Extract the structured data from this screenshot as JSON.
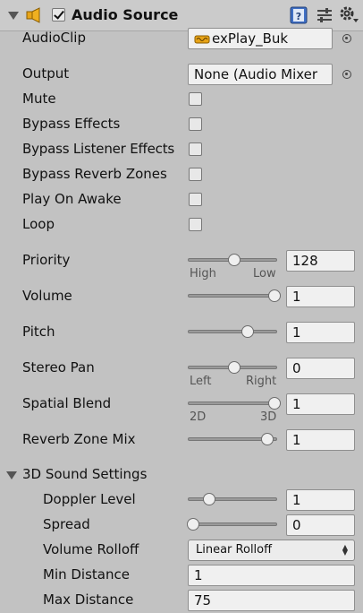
{
  "component": {
    "title": "Audio Source",
    "enabled": true,
    "icons": [
      "collapse-arrow-icon",
      "speaker-icon",
      "help-book-icon",
      "presets-icon",
      "gear-icon"
    ]
  },
  "fields": {
    "audio_clip": {
      "label": "AudioClip",
      "value": "exPlay_Buk"
    },
    "output": {
      "label": "Output",
      "value": "None (Audio Mixer"
    },
    "mute": {
      "label": "Mute",
      "checked": false
    },
    "bypass_effects": {
      "label": "Bypass Effects",
      "checked": false
    },
    "bypass_listener_effects": {
      "label": "Bypass Listener Effects",
      "checked": false
    },
    "bypass_reverb_zones": {
      "label": "Bypass Reverb Zones",
      "checked": false
    },
    "play_on_awake": {
      "label": "Play On Awake",
      "checked": false
    },
    "loop": {
      "label": "Loop",
      "checked": false
    },
    "priority": {
      "label": "Priority",
      "value": "128",
      "min": 0,
      "max": 256,
      "left_label": "High",
      "right_label": "Low"
    },
    "volume": {
      "label": "Volume",
      "value": "1",
      "min": 0,
      "max": 1
    },
    "pitch": {
      "label": "Pitch",
      "value": "1",
      "min": -3,
      "max": 3
    },
    "stereo_pan": {
      "label": "Stereo Pan",
      "value": "0",
      "min": -1,
      "max": 1,
      "left_label": "Left",
      "right_label": "Right"
    },
    "spatial_blend": {
      "label": "Spatial Blend",
      "value": "1",
      "min": 0,
      "max": 1,
      "left_label": "2D",
      "right_label": "3D"
    },
    "reverb_zone_mix": {
      "label": "Reverb Zone Mix",
      "value": "1",
      "min": 0,
      "max": 1.1
    }
  },
  "sound3d": {
    "title": "3D Sound Settings",
    "doppler_level": {
      "label": "Doppler Level",
      "value": "1",
      "min": 0,
      "max": 5
    },
    "spread": {
      "label": "Spread",
      "value": "0",
      "min": 0,
      "max": 360
    },
    "volume_rolloff": {
      "label": "Volume Rolloff",
      "value": "Linear Rolloff"
    },
    "min_distance": {
      "label": "Min Distance",
      "value": "1"
    },
    "max_distance": {
      "label": "Max Distance",
      "value": "75"
    }
  }
}
